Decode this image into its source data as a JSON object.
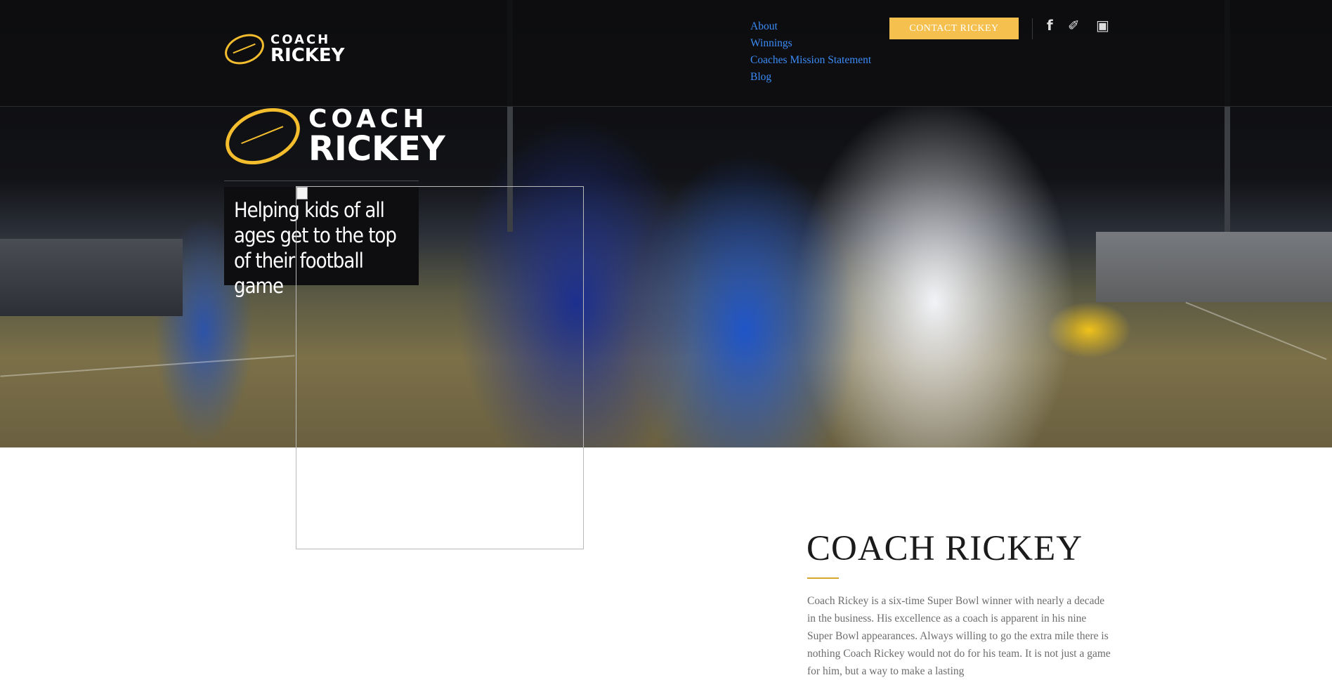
{
  "brand": {
    "line1": "COACH",
    "line2": "RICKEY"
  },
  "nav": {
    "items": [
      "About",
      "Winnings",
      "Coaches Mission Statement",
      "Blog"
    ]
  },
  "contact_button": "CONTACT RICKEY",
  "social": [
    {
      "icon": "facebook-icon",
      "glyph": "f"
    },
    {
      "icon": "twitter-icon",
      "glyph": "✐"
    },
    {
      "icon": "instagram-icon",
      "glyph": "▣"
    }
  ],
  "hero": {
    "tagline": "Helping kids of all ages get to the top of their football game"
  },
  "about": {
    "title": "COACH  RICKEY",
    "bio": "Coach Rickey is a six-time Super Bowl winner with nearly a decade in the business. His excellence as a coach is apparent in his nine Super Bowl appearances. Always willing to go the extra mile there is nothing Coach Rickey would not do for his team. It is not just a game for him, but a way to make a lasting"
  },
  "colors": {
    "accent": "#f5c04e",
    "nav_link": "#3b8bf6",
    "header_bg": "#0e0e10"
  }
}
